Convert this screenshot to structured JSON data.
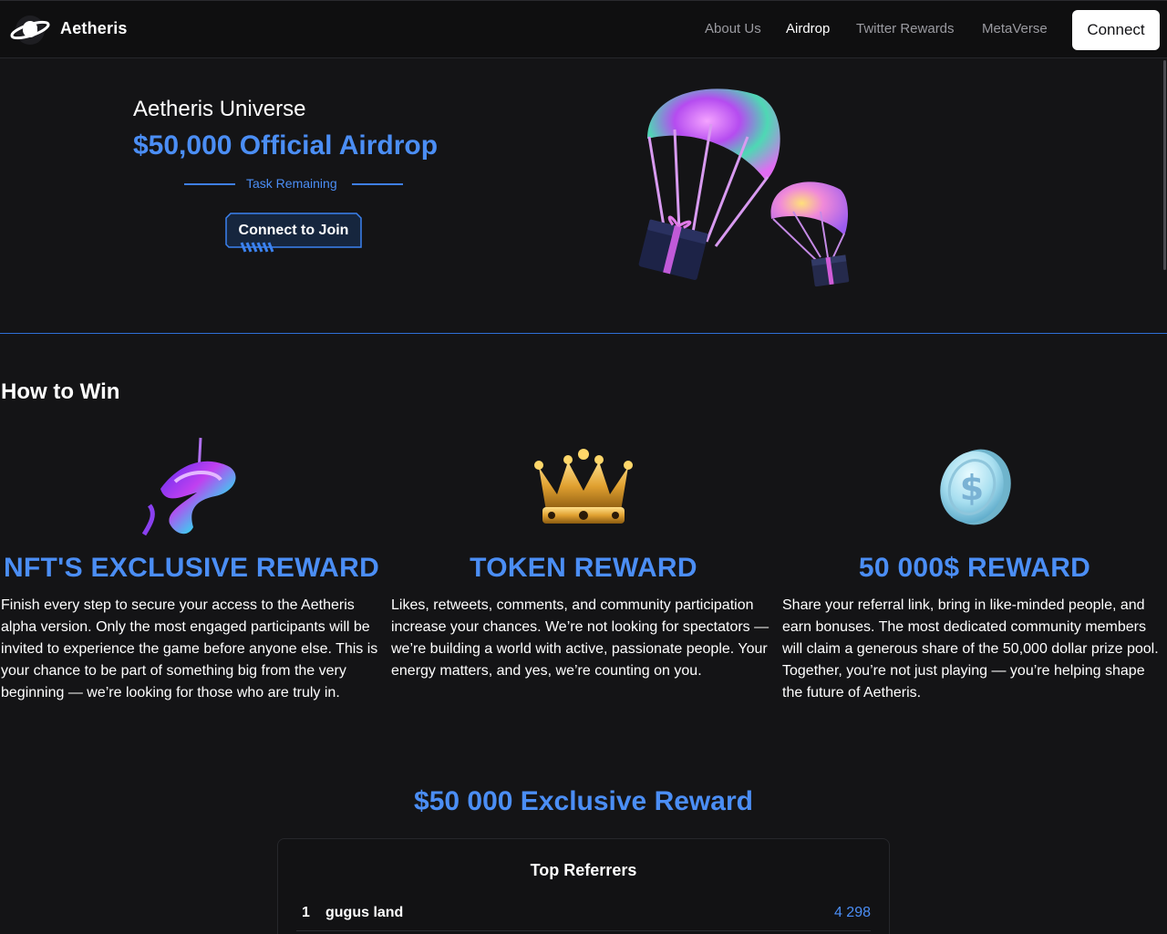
{
  "header": {
    "brand": "Aetheris",
    "logo_icon": "planet-ring-icon",
    "nav": [
      {
        "label": "About Us",
        "active": false
      },
      {
        "label": "Airdrop",
        "active": true
      },
      {
        "label": "Twitter Rewards",
        "active": false
      },
      {
        "label": "MetaVerse",
        "active": false
      }
    ],
    "connect_label": "Connect"
  },
  "hero": {
    "subtitle": "Aetheris Universe",
    "title": "$50,000 Official Airdrop",
    "task_label": "Task Remaining",
    "join_label": "Connect to Join",
    "illustration": "gift-parachutes-icon"
  },
  "how_to_win": {
    "title": "How to Win",
    "columns": [
      {
        "icon": "nft-sculpture-icon",
        "title": "NFT'S EXCLUSIVE REWARD",
        "text": "Finish every step to secure your access to the Aetheris alpha version. Only the most engaged participants will be invited to experience the game before anyone else. This is your chance to be part of something big from the very beginning — we’re looking for those who are truly in."
      },
      {
        "icon": "gold-crown-icon",
        "title": "TOKEN REWARD",
        "text": "Likes, retweets, comments, and community participation increase your chances. We’re not looking for spectators — we’re building a world with active, passionate people. Your energy matters, and yes, we’re counting on you."
      },
      {
        "icon": "dollar-coin-icon",
        "title": "50 000$ REWARD",
        "text": "Share your referral link, bring in like-minded people, and earn bonuses. The most dedicated community members will claim a generous share of the 50,000 dollar prize pool. Together, you’re not just playing — you’re helping shape the future of Aetheris."
      }
    ]
  },
  "exclusive": {
    "title": "$50 000 Exclusive Reward",
    "panel_title": "Top Referrers",
    "rows": [
      {
        "rank": "1",
        "name": "gugus land",
        "score": "4 298"
      }
    ]
  },
  "colors": {
    "accent": "#4b8ef5",
    "background": "#141416",
    "header_bg": "#0f0f10"
  }
}
